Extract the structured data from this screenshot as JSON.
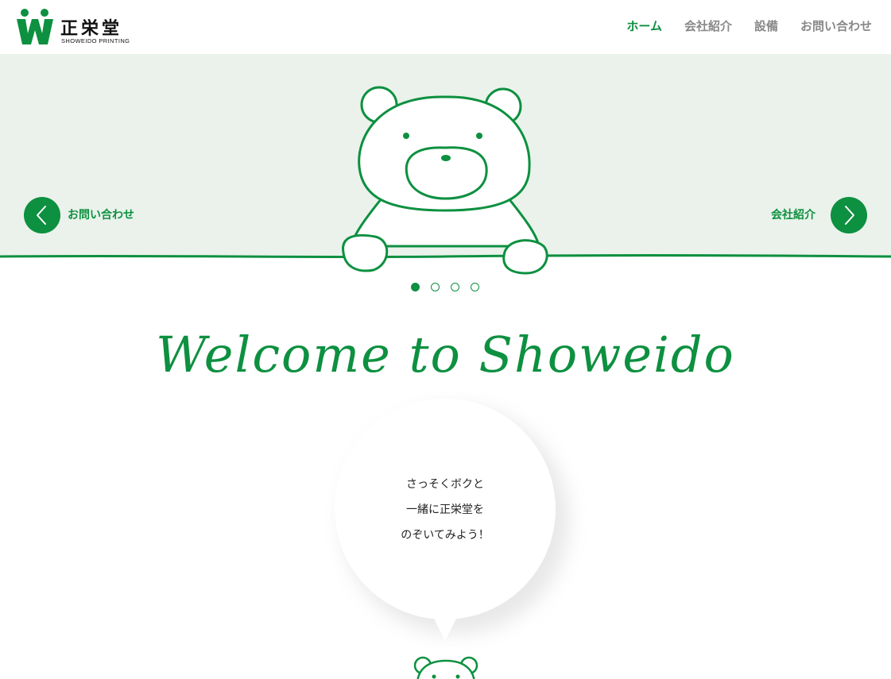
{
  "header": {
    "logo": {
      "kanji": "正栄堂",
      "subtitle": "SHOWEIDO PRINTING",
      "icon": "showeido-w-logo-icon"
    },
    "nav": [
      {
        "label": "ホーム",
        "active": true
      },
      {
        "label": "会社紹介",
        "active": false
      },
      {
        "label": "設備",
        "active": false
      },
      {
        "label": "お問い合わせ",
        "active": false
      }
    ]
  },
  "hero": {
    "prev_label": "お問い合わせ",
    "next_label": "会社紹介",
    "prev_icon": "chevron-left-icon",
    "next_icon": "chevron-right-icon",
    "illustration": "bear-illustration",
    "slides": 4,
    "active_slide": 1
  },
  "welcome": {
    "title": "Welcome to Showeido"
  },
  "bubble": {
    "lines": [
      "さっそくボクと",
      "一緒に正栄堂を",
      "のぞいてみよう！"
    ]
  },
  "colors": {
    "brand_green": "#0d9040",
    "hero_bg": "#eaf2eb",
    "nav_inactive": "#888888"
  }
}
